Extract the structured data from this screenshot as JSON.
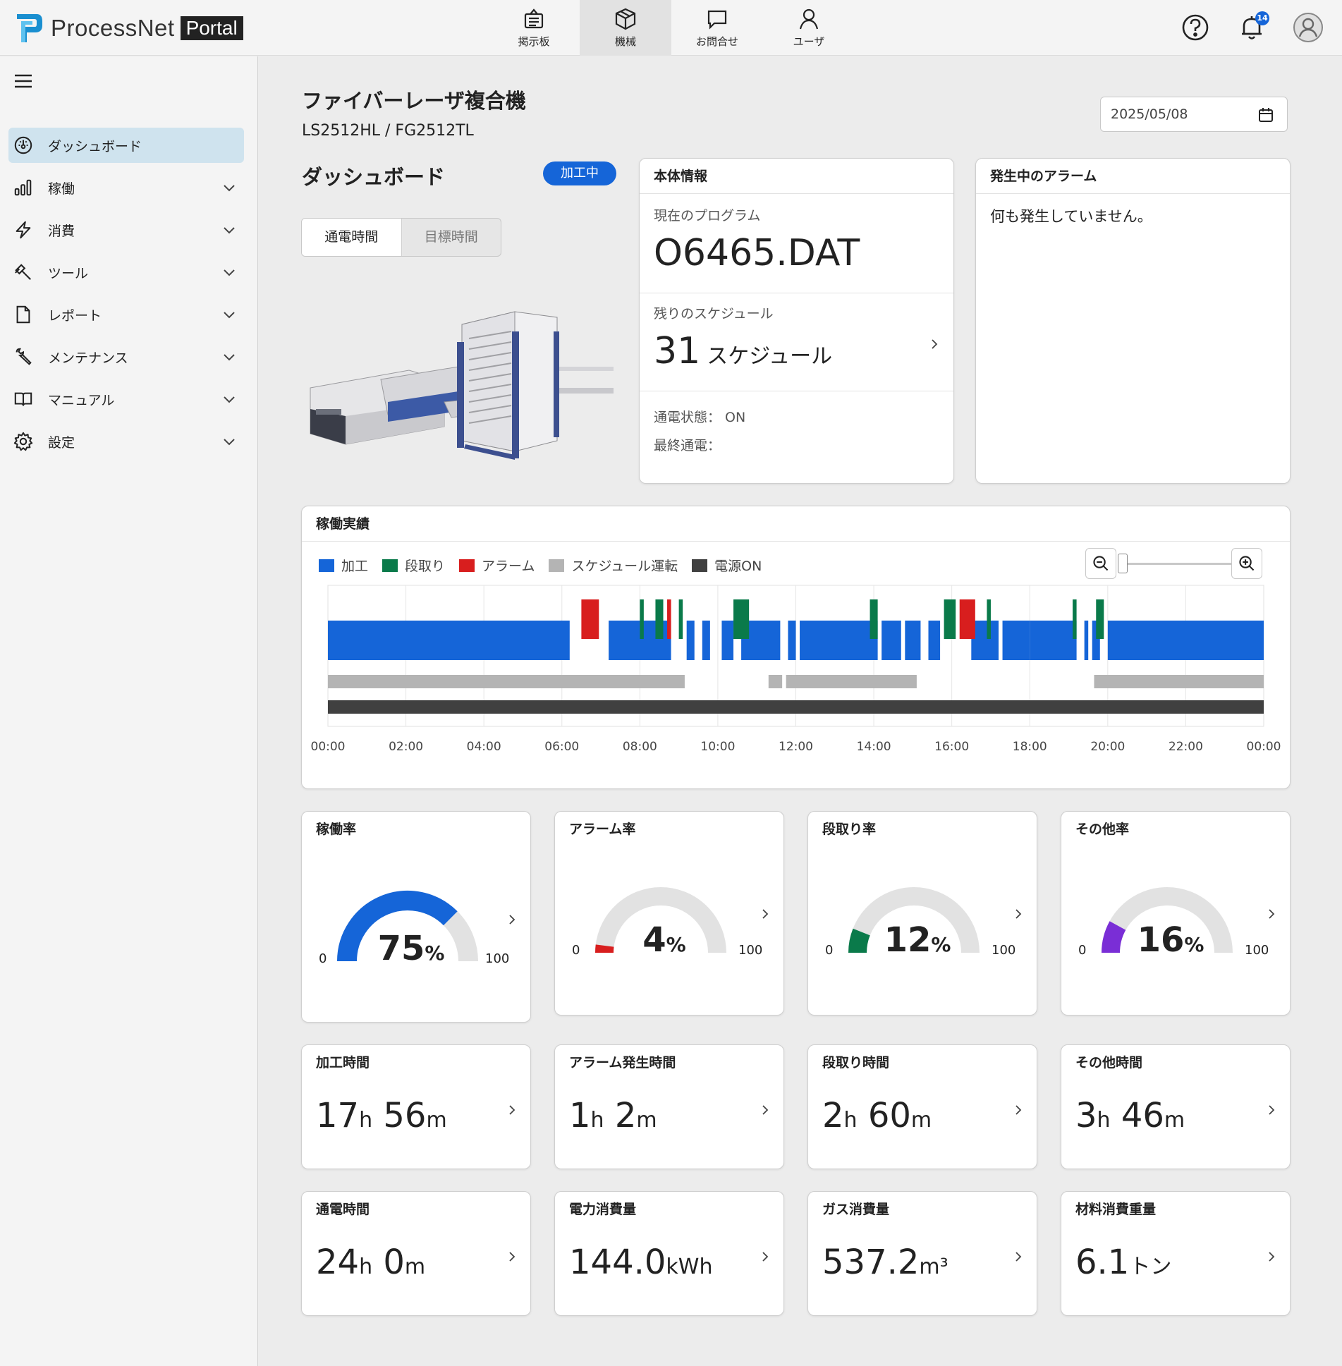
{
  "app": {
    "logo_text": "ProcessNet",
    "logo_badge": "Portal"
  },
  "topnav": [
    {
      "label": "掲示板",
      "icon": "bulletin-board-icon"
    },
    {
      "label": "機械",
      "icon": "machine-box-icon",
      "active": true
    },
    {
      "label": "お問合せ",
      "icon": "chat-bubble-icon"
    },
    {
      "label": "ユーザ",
      "icon": "user-icon"
    }
  ],
  "header": {
    "notification_count": "14"
  },
  "sidebar": {
    "items": [
      {
        "label": "ダッシュボード",
        "icon": "dashboard-gauge-icon",
        "active": true
      },
      {
        "label": "稼働",
        "icon": "bar-chart-icon"
      },
      {
        "label": "消費",
        "icon": "lightning-icon"
      },
      {
        "label": "ツール",
        "icon": "hammer-icon"
      },
      {
        "label": "レポート",
        "icon": "document-icon"
      },
      {
        "label": "メンテナンス",
        "icon": "wrench-icon"
      },
      {
        "label": "マニュアル",
        "icon": "book-icon"
      },
      {
        "label": "設定",
        "icon": "gear-icon"
      }
    ]
  },
  "machine": {
    "title": "ファイバーレーザ複合機",
    "model": "LS2512HL / FG2512TL"
  },
  "date": "2025/05/08",
  "dashboard": {
    "title": "ダッシュボード",
    "status": "加工中",
    "segments": [
      "通電時間",
      "目標時間"
    ]
  },
  "info": {
    "title": "本体情報",
    "program_label": "現在のプログラム",
    "program": "O6465.DAT",
    "schedule_label": "残りのスケジュール",
    "schedule_count": "31",
    "schedule_unit": "スケジュール",
    "power_state": "通電状態： ON",
    "last_power": "最終通電："
  },
  "alarm": {
    "title": "発生中のアラーム",
    "message": "何も発生していません。"
  },
  "timeline": {
    "title": "稼働実績",
    "legend": [
      {
        "label": "加工",
        "color": "#1565d8"
      },
      {
        "label": "段取り",
        "color": "#0a7a4a"
      },
      {
        "label": "アラーム",
        "color": "#d81e1e"
      },
      {
        "label": "スケジュール運転",
        "color": "#b4b4b4"
      },
      {
        "label": "電源ON",
        "color": "#404040"
      }
    ],
    "ticks": [
      "00:00",
      "02:00",
      "04:00",
      "06:00",
      "08:00",
      "10:00",
      "12:00",
      "14:00",
      "16:00",
      "18:00",
      "20:00",
      "22:00",
      "00:00"
    ]
  },
  "chart_data": {
    "type": "bar",
    "title": "稼働実績",
    "x_range_hours": [
      0,
      24
    ],
    "processing": [
      [
        0,
        6.2
      ],
      [
        7.2,
        8.8
      ],
      [
        9.2,
        9.4
      ],
      [
        9.6,
        9.8
      ],
      [
        10.1,
        10.4
      ],
      [
        10.6,
        11.6
      ],
      [
        11.8,
        12.0
      ],
      [
        12.1,
        14.1
      ],
      [
        14.2,
        14.7
      ],
      [
        14.8,
        15.2
      ],
      [
        15.4,
        15.7
      ],
      [
        16.5,
        17.2
      ],
      [
        17.3,
        18.0
      ],
      [
        18.0,
        19.2
      ],
      [
        19.4,
        19.5
      ],
      [
        19.6,
        19.8
      ],
      [
        20.0,
        24.0
      ]
    ],
    "setup": [
      [
        8.0,
        8.1
      ],
      [
        8.4,
        8.6
      ],
      [
        9.0,
        9.1
      ],
      [
        10.4,
        10.8
      ],
      [
        13.9,
        14.1
      ],
      [
        15.8,
        16.1
      ],
      [
        16.9,
        17.0
      ],
      [
        19.1,
        19.2
      ],
      [
        19.7,
        19.9
      ]
    ],
    "alarm": [
      [
        6.5,
        6.95
      ],
      [
        8.7,
        8.8
      ],
      [
        16.2,
        16.6
      ]
    ],
    "schedule": [
      [
        0,
        9.15
      ],
      [
        11.3,
        11.65
      ],
      [
        11.75,
        15.1
      ],
      [
        19.65,
        24.0
      ]
    ],
    "power_on": [
      [
        0,
        24.0
      ]
    ]
  },
  "gauges": [
    {
      "title": "稼働率",
      "value": 75,
      "unit": "%",
      "min": "0",
      "max": "100",
      "color": "#1565d8"
    },
    {
      "title": "アラーム率",
      "value": 4,
      "unit": "%",
      "min": "0",
      "max": "100",
      "color": "#d81e1e"
    },
    {
      "title": "段取り率",
      "value": 12,
      "unit": "%",
      "min": "0",
      "max": "100",
      "color": "#0a7a4a"
    },
    {
      "title": "その他率",
      "value": 16,
      "unit": "%",
      "min": "0",
      "max": "100",
      "color": "#7a2ed6"
    }
  ],
  "metrics_time": [
    {
      "title": "加工時間",
      "h": "17",
      "m": "56"
    },
    {
      "title": "アラーム発生時間",
      "h": "1",
      "m": "2"
    },
    {
      "title": "段取り時間",
      "h": "2",
      "m": "60"
    },
    {
      "title": "その他時間",
      "h": "3",
      "m": "46"
    }
  ],
  "metrics_usage": [
    {
      "title": "通電時間",
      "h": "24",
      "m": "0",
      "h_unit": "h",
      "m_unit": "m"
    },
    {
      "title": "電力消費量",
      "value": "144.0",
      "unit": "kWh"
    },
    {
      "title": "ガス消費量",
      "value": "537.2",
      "unit": "m³"
    },
    {
      "title": "材料消費重量",
      "value": "6.1",
      "unit": "トン"
    }
  ],
  "units": {
    "h": "h",
    "m": "m"
  }
}
